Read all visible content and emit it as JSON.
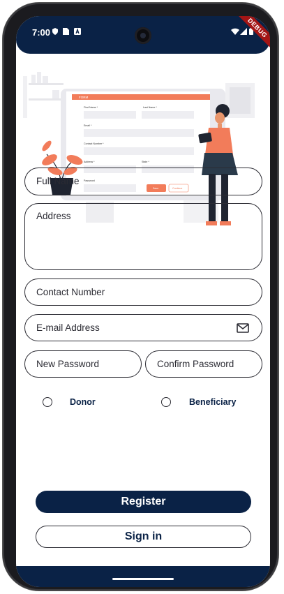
{
  "status_bar": {
    "time": "7:00",
    "debug_banner": "DEBUG"
  },
  "form": {
    "full_name_label": "Full Name",
    "address_label": "Address",
    "contact_label": "Contact Number",
    "email_label": "E-mail Address",
    "new_password_label": "New Password",
    "confirm_password_label": "Confirm Password"
  },
  "roles": {
    "donor_label": "Donor",
    "beneficiary_label": "Beneficiary"
  },
  "actions": {
    "register_label": "Register",
    "signin_label": "Sign in"
  },
  "illustration": {
    "form_header": "FORM",
    "first_name": "First Name *",
    "last_name": "Last Name *",
    "email": "Email *",
    "contact_number": "Contact Number *",
    "address": "Address *",
    "state": "State *",
    "password": "Password",
    "save": "Save",
    "continue": "Continue"
  },
  "colors": {
    "primary": "#0a2246",
    "accent": "#f27c5a",
    "outline": "#2b2b33"
  }
}
